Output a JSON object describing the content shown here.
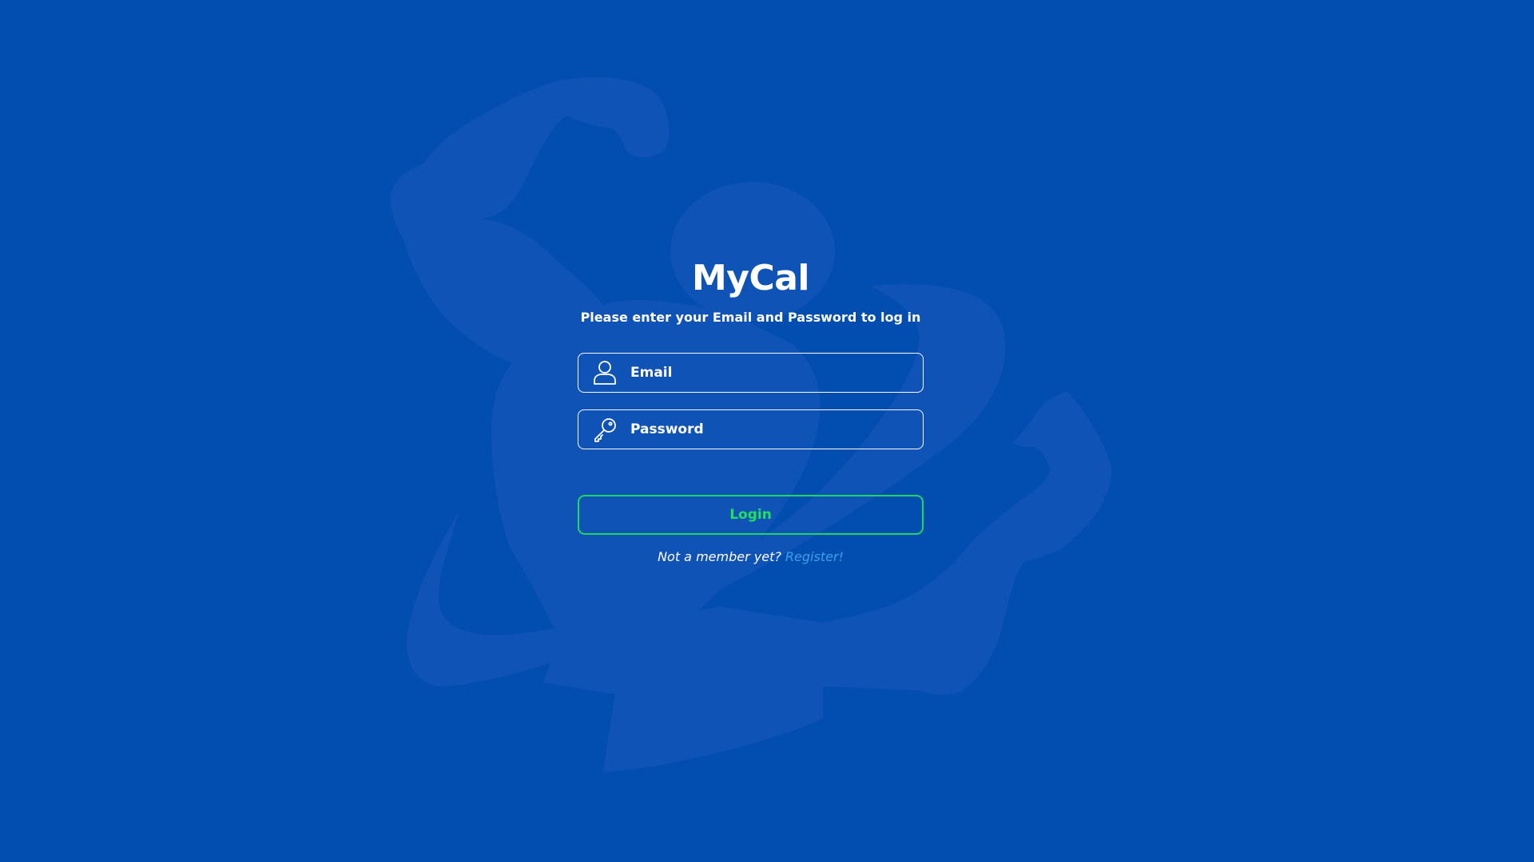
{
  "app": {
    "title": "MyCal",
    "subtitle": "Please enter your Email and Password to log in"
  },
  "form": {
    "email": {
      "placeholder": "Email",
      "value": "",
      "icon": "user-icon"
    },
    "password": {
      "placeholder": "Password",
      "value": "",
      "icon": "key-icon"
    },
    "login_label": "Login",
    "register_prompt": "Not a member yet?",
    "register_link": "Register!"
  },
  "colors": {
    "background": "#014eb0",
    "mascot": "#1556b8",
    "text": "#ffffff",
    "login_accent": "#1ed760",
    "link": "#3aa2e8"
  },
  "background": {
    "mascot": "flexing-strongman-logo"
  }
}
